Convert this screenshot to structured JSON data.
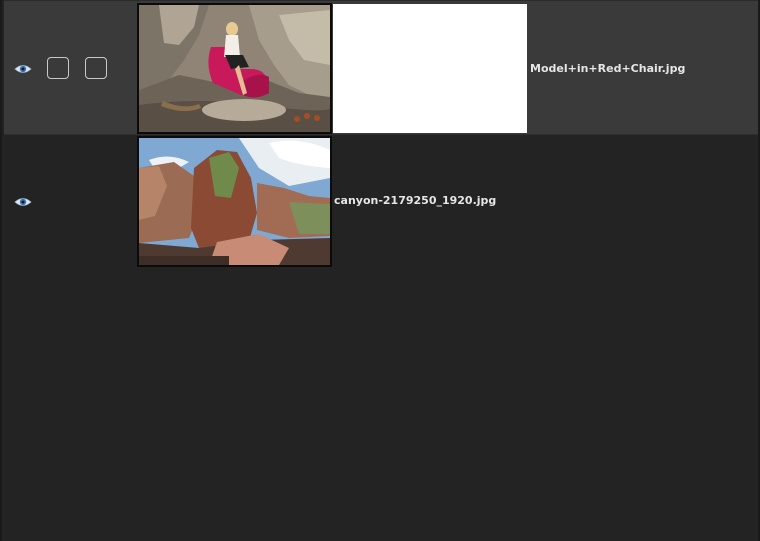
{
  "layers": [
    {
      "name": "Model+in+Red+Chair.jpg",
      "visible": true,
      "selected": true,
      "has_mask": true,
      "visibility_icon": "eye-icon",
      "thumbnail_icon": "photo-model-red-chair"
    },
    {
      "name": "canyon-2179250_1920.jpg",
      "visible": true,
      "selected": false,
      "has_mask": false,
      "visibility_icon": "eye-icon",
      "thumbnail_icon": "photo-canyon"
    }
  ],
  "colors": {
    "panel_background": "#232323",
    "selected_row_background": "#3a3a3a",
    "text": "#e6e6e6",
    "mask_fill": "#ffffff",
    "eye_icon": "#b9d3f0"
  }
}
